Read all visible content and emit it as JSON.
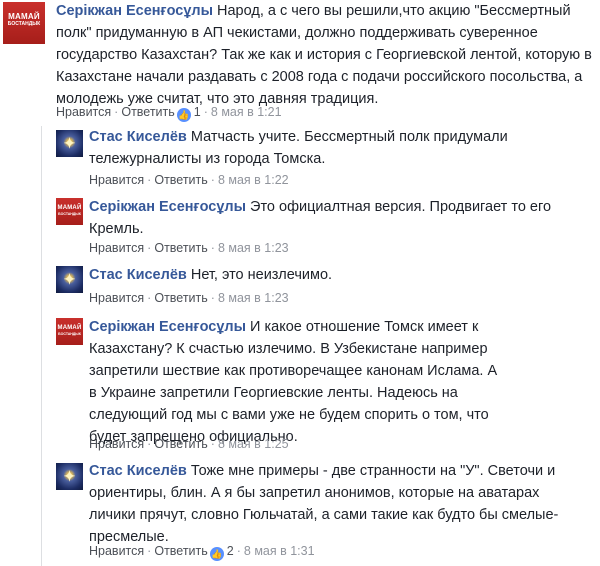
{
  "comments": [
    {
      "author": "Серікжан Есенғосұлы",
      "text": "Народ, а с чего вы решили,что акцию \"Бессмертный полк\" придуманную в АП чекистами, должно поддерживать суверенное государство Казахстан? Так же как и история с Георгиевской лентой, которую в Казахстане начали раздавать с 2008 года с подачи российского посольства, а молодежь уже считат, что это давняя традиция.",
      "like_label": "Нравится",
      "reply_label": "Ответить",
      "reaction_count": "1",
      "timestamp": "8 мая в 1:21",
      "avatar_text_1": "МАМАЙ",
      "avatar_text_2": "БОСТАНДЫК"
    },
    {
      "author": "Стас Киселёв",
      "text": "Матчасть учите. Бессмертный полк придумали тележурналисты из города Томска.",
      "like_label": "Нравится",
      "reply_label": "Ответить",
      "timestamp": "8 мая в 1:22"
    },
    {
      "author": "Серікжан Есенғосұлы",
      "text": "Это официалтная версия. Продвигает то его Кремль.",
      "like_label": "Нравится",
      "reply_label": "Ответить",
      "timestamp": "8 мая в 1:23",
      "avatar_text_1": "МАМАЙ",
      "avatar_text_2": "БОСТАНДЫК"
    },
    {
      "author": "Стас Киселёв",
      "text": "Нет, это неизлечимо.",
      "like_label": "Нравится",
      "reply_label": "Ответить",
      "timestamp": "8 мая в 1:23"
    },
    {
      "author": "Серікжан Есенғосұлы",
      "text": "И какое отношение Томск имеет к Казахстану? К счастью излечимо. В Узбекистане например запретили шествие как противоречащее канонам Ислама. А в Украине запретили Георгиевские ленты. Надеюсь на следующий год мы с вами уже не будем спорить о том, что будет запрещено официально.",
      "like_label": "Нравится",
      "reply_label": "Ответить",
      "timestamp": "8 мая в 1:25",
      "avatar_text_1": "МАМАЙ",
      "avatar_text_2": "БОСТАНДЫК"
    },
    {
      "author": "Стас Киселёв",
      "text": "Тоже мне примеры - две странности на \"У\". Светочи и ориентиры, блин. А я бы запретил анонимов, которые на аватарах личики прячут, словно Гюльчатай, а сами такие как будто бы смелые-пресмелые.",
      "like_label": "Нравится",
      "reply_label": "Ответить",
      "reaction_count": "2",
      "timestamp": "8 мая в 1:31"
    }
  ],
  "colors": {
    "author_link": "#365899",
    "meta_gray": "#90949c",
    "like_blue": "#5890ff",
    "avatar_red": "#c9302c"
  },
  "icons": {
    "reaction": "like-thumb-icon",
    "star_avatar": "star-icon"
  }
}
